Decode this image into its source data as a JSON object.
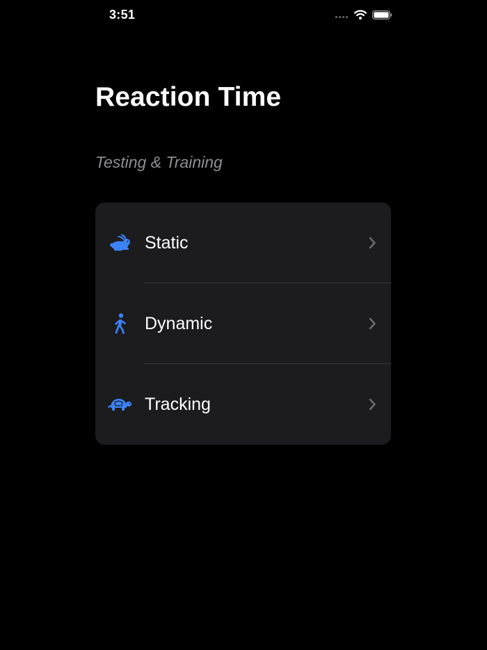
{
  "status_bar": {
    "time": "3:51",
    "icons": [
      "signal-dots-icon",
      "wifi-icon",
      "battery-icon"
    ]
  },
  "header": {
    "title": "Reaction Time",
    "subtitle": "Testing & Training"
  },
  "menu": {
    "items": [
      {
        "label": "Static",
        "icon": "rabbit-icon"
      },
      {
        "label": "Dynamic",
        "icon": "walking-person-icon"
      },
      {
        "label": "Tracking",
        "icon": "turtle-icon"
      }
    ]
  },
  "colors": {
    "background": "#000000",
    "card": "#1c1c1e",
    "accent": "#3b82f6",
    "subtitle": "#8e8e93",
    "chevron": "#6e6e73"
  }
}
